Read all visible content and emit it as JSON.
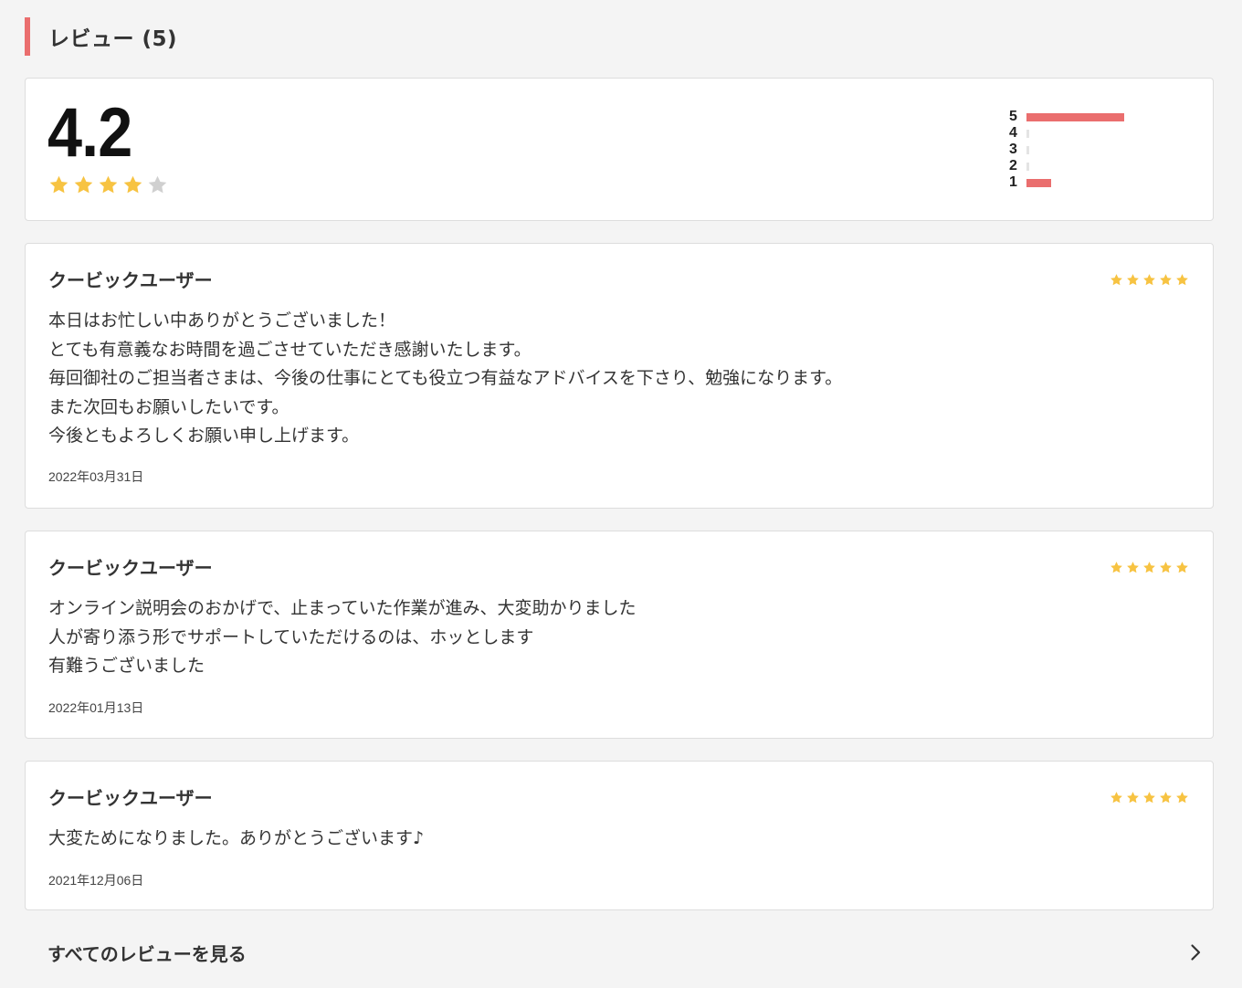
{
  "section": {
    "title": "レビュー (5)"
  },
  "summary": {
    "average": "4.2",
    "stars_filled": 4,
    "stars_total": 5,
    "distribution": [
      {
        "label": "5",
        "fraction": 0.8
      },
      {
        "label": "4",
        "fraction": 0
      },
      {
        "label": "3",
        "fraction": 0
      },
      {
        "label": "2",
        "fraction": 0
      },
      {
        "label": "1",
        "fraction": 0.2
      }
    ]
  },
  "reviews": [
    {
      "reviewer": "クービックユーザー",
      "rating": 5,
      "body": "本日はお忙しい中ありがとうございました！\nとても有意義なお時間を過ごさせていただき感謝いたします。\n毎回御社のご担当者さまは、今後の仕事にとても役立つ有益なアドバイスを下さり、勉強になります。\nまた次回もお願いしたいです。\n今後ともよろしくお願い申し上げます。",
      "date": "2022年03月31日"
    },
    {
      "reviewer": "クービックユーザー",
      "rating": 5,
      "body": "オンライン説明会のおかげで、止まっていた作業が進み、大変助かりました\n人が寄り添う形でサポートしていただけるのは、ホッとします\n有難うございました",
      "date": "2022年01月13日"
    },
    {
      "reviewer": "クービックユーザー",
      "rating": 5,
      "body": "大変ためになりました。ありがとうございます♪",
      "date": "2021年12月06日"
    }
  ],
  "see_all": {
    "label": "すべてのレビューを見る",
    "icon": "chevron-right-icon"
  },
  "colors": {
    "accent": "#ea6e6e",
    "star": "#f7c342",
    "star_empty": "#d0d0d0"
  }
}
